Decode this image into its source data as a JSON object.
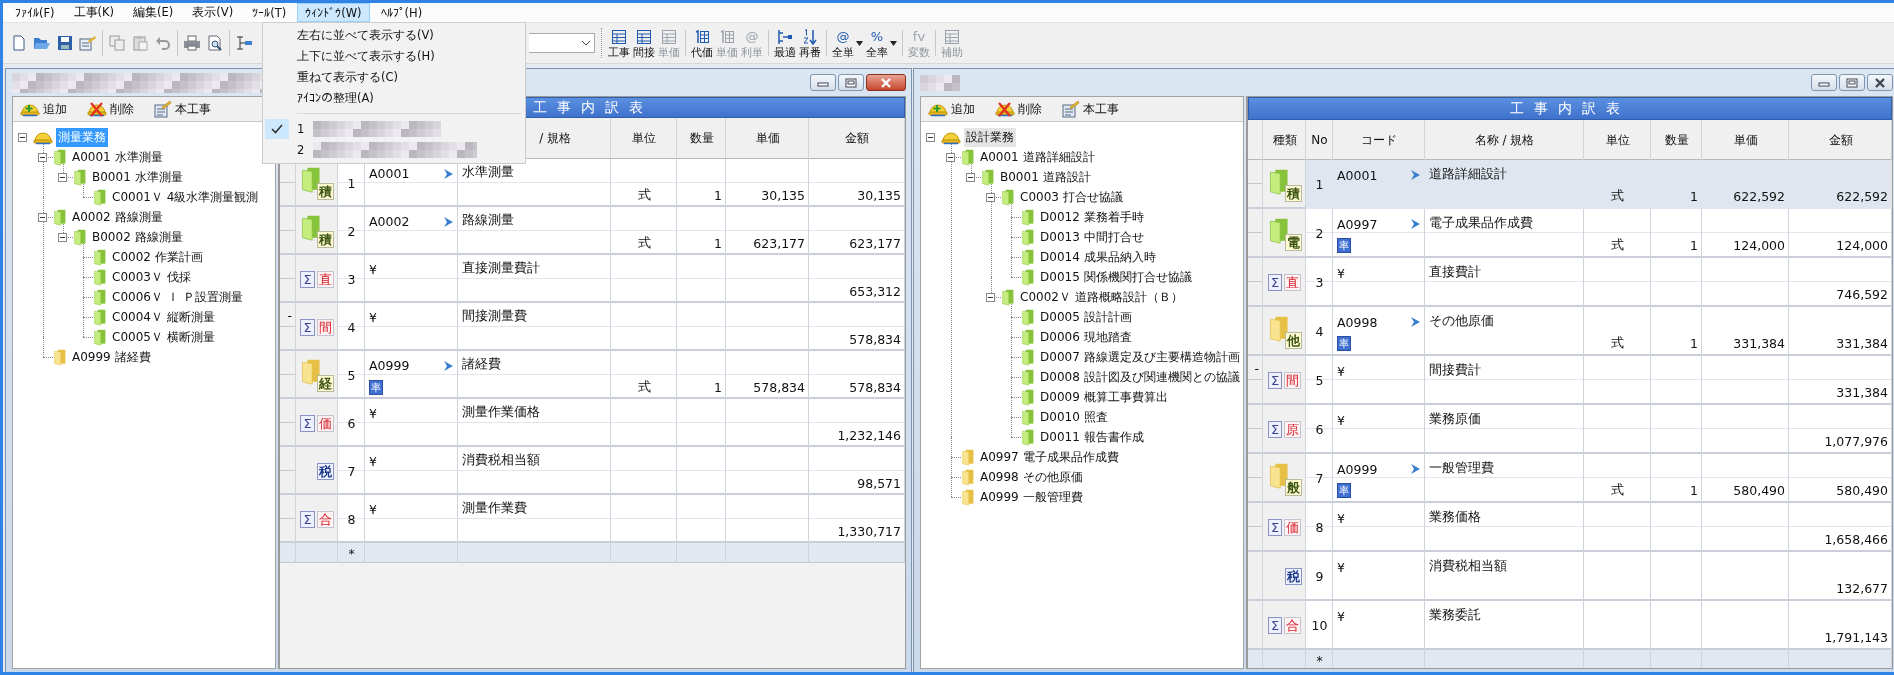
{
  "menubar": [
    {
      "label": "ﾌｧｲﾙ(F)",
      "selected": false
    },
    {
      "label": "工事(K)",
      "selected": false
    },
    {
      "label": "編集(E)",
      "selected": false
    },
    {
      "label": "表示(V)",
      "selected": false
    },
    {
      "label": "ﾂｰﾙ(T)",
      "selected": false
    },
    {
      "label": "ｳｨﾝﾄﾞｳ(W)",
      "selected": true
    },
    {
      "label": "ﾍﾙﾌﾟ(H)",
      "selected": false
    }
  ],
  "toolbar": {
    "right_groups": [
      [
        {
          "label": "工事",
          "kind": "grid",
          "disabled": false
        },
        {
          "label": "間接",
          "kind": "grid",
          "disabled": false
        },
        {
          "label": "単価",
          "kind": "grid",
          "disabled": true
        }
      ],
      [
        {
          "label": "代価",
          "kind": "numgrid",
          "disabled": false
        },
        {
          "label": "単価",
          "kind": "numgrid",
          "disabled": true
        },
        {
          "label": "利単",
          "glyph": "@",
          "disabled": true
        }
      ],
      [
        {
          "label": "最適",
          "kind": "fit",
          "disabled": false
        },
        {
          "label": "再番",
          "kind": "sort",
          "disabled": false
        }
      ],
      [
        {
          "label": "全単",
          "glyph": "@",
          "disabled": false,
          "dropdown": true
        },
        {
          "label": "全率",
          "glyph": "%",
          "disabled": false,
          "dropdown": true
        }
      ],
      [
        {
          "label": "変数",
          "glyph": "fv",
          "disabled": true
        }
      ],
      [
        {
          "label": "補助",
          "kind": "grid",
          "disabled": true
        }
      ]
    ]
  },
  "window_menu": {
    "items": [
      {
        "label": "左右に並べて表示する(V)"
      },
      {
        "label": "上下に並べて表示する(H)"
      },
      {
        "label": "重ねて表示する(C)"
      },
      {
        "label": "ｱｲｺﾝの整理(A)"
      }
    ],
    "windows": [
      {
        "label": "1",
        "checked": true
      },
      {
        "label": "2",
        "checked": false
      }
    ]
  },
  "windows": [
    {
      "active": true,
      "tree_toolbar": [
        {
          "label": "追加",
          "kind": "add"
        },
        {
          "label": "削除",
          "kind": "delete"
        },
        {
          "label": "本工事",
          "kind": "main"
        }
      ],
      "tree": {
        "label": "測量業務",
        "kind": "root",
        "selected": true,
        "expanded": true,
        "children": [
          {
            "label": "A0001 水準測量",
            "kind": "folder_green",
            "selected": false,
            "expanded": true,
            "children": [
              {
                "label": "B0001 水準測量",
                "kind": "folder_green",
                "selected": false,
                "expanded": true,
                "children": [
                  {
                    "label": "C0001Ｖ 4級水準測量観測",
                    "kind": "folder_green",
                    "selected": false
                  }
                ]
              }
            ]
          },
          {
            "label": "A0002 路線測量",
            "kind": "folder_green",
            "selected": false,
            "expanded": true,
            "children": [
              {
                "label": "B0002 路線測量",
                "kind": "folder_green",
                "selected": false,
                "expanded": true,
                "children": [
                  {
                    "label": "C0002 作業計画",
                    "kind": "folder_green",
                    "selected": false
                  },
                  {
                    "label": "C0003Ｖ 伐採",
                    "kind": "folder_green",
                    "selected": false
                  },
                  {
                    "label": "C0006Ｖ Ｉ Ｐ設置測量",
                    "kind": "folder_green",
                    "selected": false
                  },
                  {
                    "label": "C0004Ｖ 縦断測量",
                    "kind": "folder_green",
                    "selected": false
                  },
                  {
                    "label": "C0005Ｖ 横断測量",
                    "kind": "folder_green",
                    "selected": false
                  }
                ]
              }
            ]
          },
          {
            "label": "A0999 諸経費",
            "kind": "folder_yellow",
            "selected": false
          }
        ]
      },
      "table": {
        "title": "工事内訳表",
        "header": [
          "/ 規格",
          "単位",
          "数量",
          "単価",
          "金額"
        ],
        "rows": [
          {
            "kind": "folder_green",
            "badge": "積",
            "no": "1",
            "code": "A0001",
            "arrow": true,
            "name": "水準測量",
            "unit": "式",
            "qty": "1",
            "price": "30,135",
            "amount": "30,135",
            "selected": false
          },
          {
            "kind": "folder_green",
            "badge": "積",
            "no": "2",
            "code": "A0002",
            "arrow": true,
            "name": "路線測量",
            "unit": "式",
            "qty": "1",
            "price": "623,177",
            "amount": "623,177",
            "selected": false
          },
          {
            "kind": "sum",
            "sigma": "Σ",
            "badge": "直",
            "no": "3",
            "code": "¥",
            "name": "直接測量費計",
            "amount": "653,312",
            "selected": false
          },
          {
            "kind": "sum",
            "sigma": "Σ",
            "badge": "間",
            "gutter": "-",
            "no": "4",
            "code": "¥",
            "name": "間接測量費",
            "amount": "578,834",
            "selected": false
          },
          {
            "kind": "folder_yellow",
            "badge": "経",
            "no": "5",
            "code": "A0999",
            "arrow": true,
            "rate": "率",
            "name": "諸経費",
            "unit": "式",
            "qty": "1",
            "price": "578,834",
            "amount": "578,834",
            "selected": false
          },
          {
            "kind": "sum",
            "sigma": "Σ",
            "badge": "価",
            "no": "6",
            "code": "¥",
            "name": "測量作業価格",
            "amount": "1,232,146",
            "selected": false
          },
          {
            "kind": "tax",
            "badge": "税",
            "no": "7",
            "code": "¥",
            "name": "消費税相当額",
            "amount": "98,571",
            "selected": false
          },
          {
            "kind": "sum",
            "sigma": "Σ",
            "badge": "合",
            "no": "8",
            "code": "¥",
            "name": "測量作業費",
            "amount": "1,330,717",
            "selected": false
          }
        ],
        "new_row": "*"
      }
    },
    {
      "active": false,
      "tree_toolbar": [
        {
          "label": "追加",
          "kind": "add"
        },
        {
          "label": "削除",
          "kind": "delete"
        },
        {
          "label": "本工事",
          "kind": "main"
        }
      ],
      "tree": {
        "label": "設計業務",
        "kind": "root",
        "selected": true,
        "expanded": true,
        "children": [
          {
            "label": "A0001 道路詳細設計",
            "kind": "folder_green",
            "selected": false,
            "expanded": true,
            "children": [
              {
                "label": "B0001 道路設計",
                "kind": "folder_green",
                "selected": false,
                "expanded": true,
                "children": [
                  {
                    "label": "C0003 打合せ協議",
                    "kind": "folder_green",
                    "selected": false,
                    "expanded": true,
                    "children": [
                      {
                        "label": "D0012 業務着手時",
                        "kind": "folder_green",
                        "selected": false
                      },
                      {
                        "label": "D0013 中間打合せ",
                        "kind": "folder_green",
                        "selected": false
                      },
                      {
                        "label": "D0014 成果品納入時",
                        "kind": "folder_green",
                        "selected": false
                      },
                      {
                        "label": "D0015 関係機関打合せ協議",
                        "kind": "folder_green",
                        "selected": false
                      }
                    ]
                  },
                  {
                    "label": "C0002Ｖ 道路概略設計（Ｂ）",
                    "kind": "folder_green",
                    "selected": false,
                    "expanded": true,
                    "children": [
                      {
                        "label": "D0005 設計計画",
                        "kind": "folder_green",
                        "selected": false
                      },
                      {
                        "label": "D0006 現地踏査",
                        "kind": "folder_green",
                        "selected": false
                      },
                      {
                        "label": "D0007 路線選定及び主要構造物計画",
                        "kind": "folder_green",
                        "selected": false
                      },
                      {
                        "label": "D0008 設計図及び関連機関との協議",
                        "kind": "folder_green",
                        "selected": false
                      },
                      {
                        "label": "D0009 概算工事費算出",
                        "kind": "folder_green",
                        "selected": false
                      },
                      {
                        "label": "D0010 照査",
                        "kind": "folder_green",
                        "selected": false
                      },
                      {
                        "label": "D0011 報告書作成",
                        "kind": "folder_green",
                        "selected": false
                      }
                    ]
                  }
                ]
              }
            ]
          },
          {
            "label": "A0997 電子成果品作成費",
            "kind": "folder_yellow",
            "selected": false
          },
          {
            "label": "A0998 その他原価",
            "kind": "folder_yellow",
            "selected": false
          },
          {
            "label": "A0999 一般管理費",
            "kind": "folder_yellow",
            "selected": false
          }
        ]
      },
      "table": {
        "title": "工事内訳表",
        "header": [
          "種類",
          "No",
          "コード",
          "名称 / 規格",
          "単位",
          "数量",
          "単価",
          "金額"
        ],
        "rows": [
          {
            "kind": "folder_green",
            "badge": "積",
            "no": "1",
            "code": "A0001",
            "arrow": true,
            "name": "道路詳細設計",
            "unit": "式",
            "qty": "1",
            "price": "622,592",
            "amount": "622,592",
            "selected": true
          },
          {
            "kind": "folder_green",
            "badge": "電",
            "no": "2",
            "code": "A0997",
            "arrow": true,
            "rate": "率",
            "name": "電子成果品作成費",
            "unit": "式",
            "qty": "1",
            "price": "124,000",
            "amount": "124,000",
            "selected": false
          },
          {
            "kind": "sum",
            "sigma": "Σ",
            "badge": "直",
            "no": "3",
            "code": "¥",
            "name": "直接費計",
            "amount": "746,592",
            "selected": false
          },
          {
            "kind": "folder_yellow",
            "badge": "他",
            "no": "4",
            "code": "A0998",
            "arrow": true,
            "rate": "率",
            "name": "その他原価",
            "unit": "式",
            "qty": "1",
            "price": "331,384",
            "amount": "331,384",
            "selected": false
          },
          {
            "kind": "sum",
            "sigma": "Σ",
            "badge": "間",
            "gutter": "-",
            "no": "5",
            "code": "¥",
            "name": "間接費計",
            "amount": "331,384",
            "selected": false
          },
          {
            "kind": "sum",
            "sigma": "Σ",
            "badge": "原",
            "no": "6",
            "code": "¥",
            "name": "業務原価",
            "amount": "1,077,976",
            "selected": false
          },
          {
            "kind": "folder_yellow",
            "badge": "般",
            "no": "7",
            "code": "A0999",
            "arrow": true,
            "rate": "率",
            "name": "一般管理費",
            "unit": "式",
            "qty": "1",
            "price": "580,490",
            "amount": "580,490",
            "selected": false
          },
          {
            "kind": "sum",
            "sigma": "Σ",
            "badge": "価",
            "no": "8",
            "code": "¥",
            "name": "業務価格",
            "amount": "1,658,466",
            "selected": false
          },
          {
            "kind": "tax",
            "badge": "税",
            "no": "9",
            "code": "¥",
            "name": "消費税相当額",
            "amount": "132,677",
            "selected": false
          },
          {
            "kind": "sum",
            "sigma": "Σ",
            "badge": "合",
            "no": "10",
            "code": "¥",
            "name": "業務委託",
            "amount": "1,791,143",
            "selected": false
          }
        ],
        "new_row": "*"
      }
    }
  ]
}
